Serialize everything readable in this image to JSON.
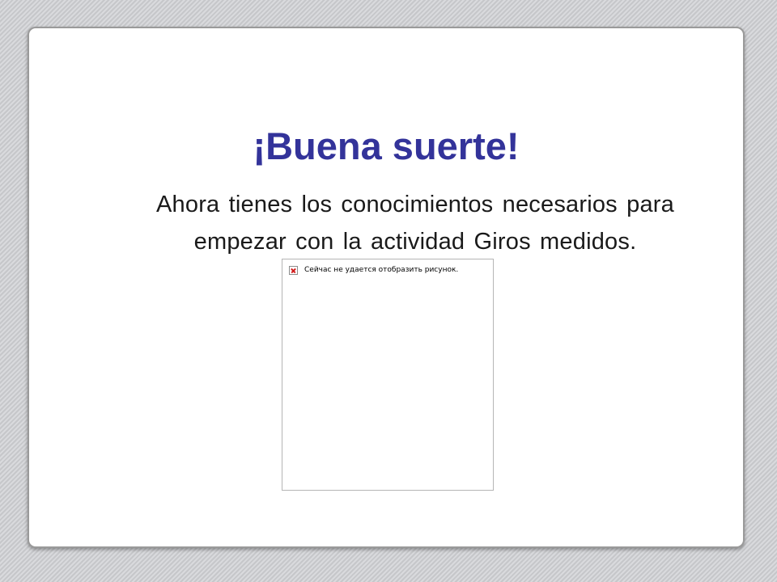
{
  "slide": {
    "title": "¡Buena suerte!",
    "body_line1": "Ahora tienes los conocimientos necesarios para",
    "body_line2": "empezar con la actividad Giros medidos.",
    "image_placeholder": {
      "message": "Сейчас не удается отобразить рисунок.",
      "icon": "broken-image-icon"
    }
  },
  "colors": {
    "title": "#33339a",
    "body_text": "#1a1a1a",
    "card_background": "#ffffff",
    "page_background": "#cfd0d3"
  }
}
